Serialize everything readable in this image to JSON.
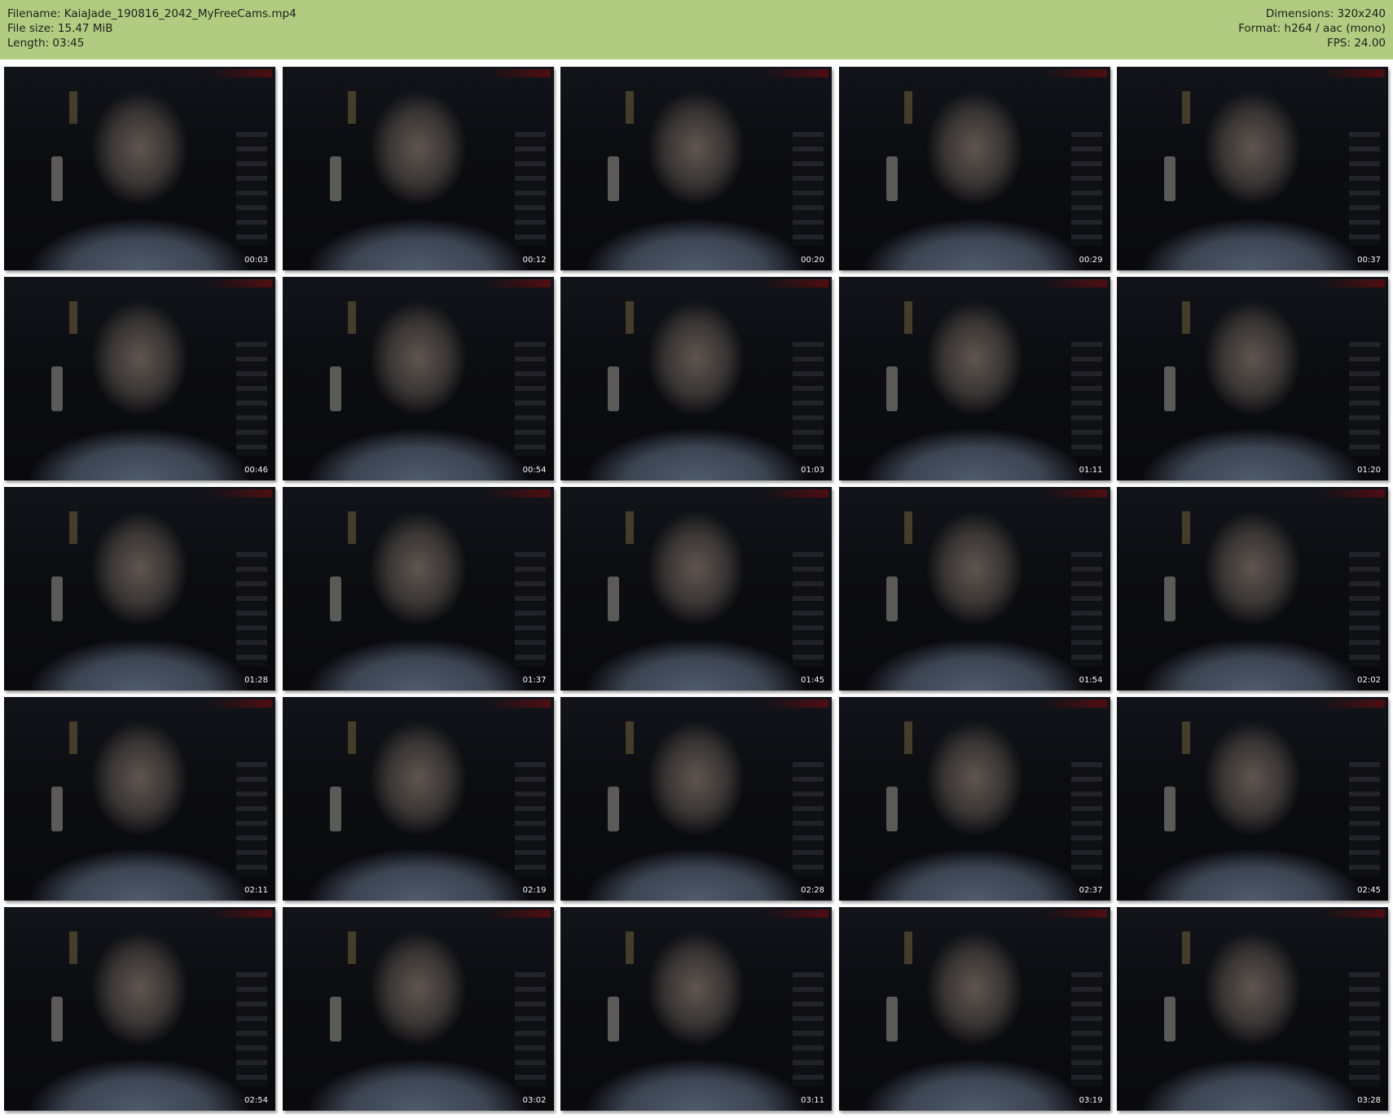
{
  "header": {
    "filename": "Filename: KaiaJade_190816_2042_MyFreeCams.mp4",
    "file_size": "File size: 15.47 MiB",
    "length": "Length: 03:45",
    "dimensions": "Dimensions: 320x240",
    "format": "Format: h264 / aac (mono)",
    "fps": "FPS: 24.00"
  },
  "colors": {
    "header_bg": "#b1cc80",
    "page_bg": "#ffffff",
    "timestamp_text": "#ffffff"
  },
  "thumbnails": [
    {
      "timestamp": "00:03"
    },
    {
      "timestamp": "00:12"
    },
    {
      "timestamp": "00:20"
    },
    {
      "timestamp": "00:29"
    },
    {
      "timestamp": "00:37"
    },
    {
      "timestamp": "00:46"
    },
    {
      "timestamp": "00:54"
    },
    {
      "timestamp": "01:03"
    },
    {
      "timestamp": "01:11"
    },
    {
      "timestamp": "01:20"
    },
    {
      "timestamp": "01:28"
    },
    {
      "timestamp": "01:37"
    },
    {
      "timestamp": "01:45"
    },
    {
      "timestamp": "01:54"
    },
    {
      "timestamp": "02:02"
    },
    {
      "timestamp": "02:11"
    },
    {
      "timestamp": "02:19"
    },
    {
      "timestamp": "02:28"
    },
    {
      "timestamp": "02:37"
    },
    {
      "timestamp": "02:45"
    },
    {
      "timestamp": "02:54"
    },
    {
      "timestamp": "03:02"
    },
    {
      "timestamp": "03:11"
    },
    {
      "timestamp": "03:19"
    },
    {
      "timestamp": "03:28"
    }
  ]
}
